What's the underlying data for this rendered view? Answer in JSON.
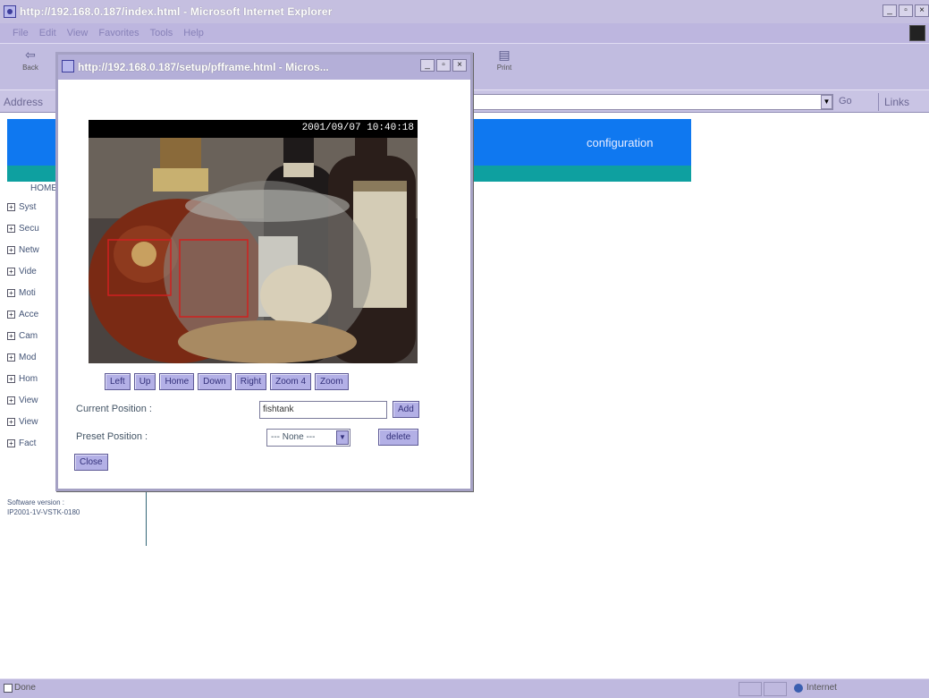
{
  "browser": {
    "title": "http://192.168.0.187/index.html - Microsoft Internet Explorer",
    "menu": [
      "File",
      "Edit",
      "View",
      "Favorites",
      "Tools",
      "Help"
    ],
    "toolbar": {
      "back_label": "Back",
      "print_label": "Print"
    },
    "address_label": "Address",
    "go_label": "Go",
    "links_label": "Links"
  },
  "page": {
    "banner_text": "configuration",
    "sidebar": {
      "home": "HOME",
      "items": [
        "Syst",
        "Secu",
        "Netw",
        "Vide",
        "Moti",
        "Acce",
        "Cam",
        "Mod",
        "Hom",
        "View",
        "View",
        "Fact"
      ]
    },
    "software_version_label": "Software version :",
    "software_version_value": "IP2001-1V-VSTK-0180"
  },
  "popup": {
    "title": "http://192.168.0.187/setup/pfframe.html - Micros...",
    "camera_timestamp": "2001/09/07 10:40:18",
    "controls": [
      "Left",
      "Up",
      "Home",
      "Down",
      "Right",
      "Zoom 4",
      "Zoom"
    ],
    "current_position_label": "Current Position :",
    "current_position_value": "fishtank",
    "add_label": "Add",
    "preset_position_label": "Preset Position :",
    "preset_value": "--- None ---",
    "delete_label": "delete",
    "close_label": "Close"
  },
  "status": {
    "left_text": "Done",
    "zone_text": "Internet"
  },
  "icons": {
    "ie_logo": "ie-logo-icon",
    "back": "back-arrow-icon",
    "print": "printer-icon",
    "status": "page-done-icon",
    "zone": "globe-icon"
  }
}
